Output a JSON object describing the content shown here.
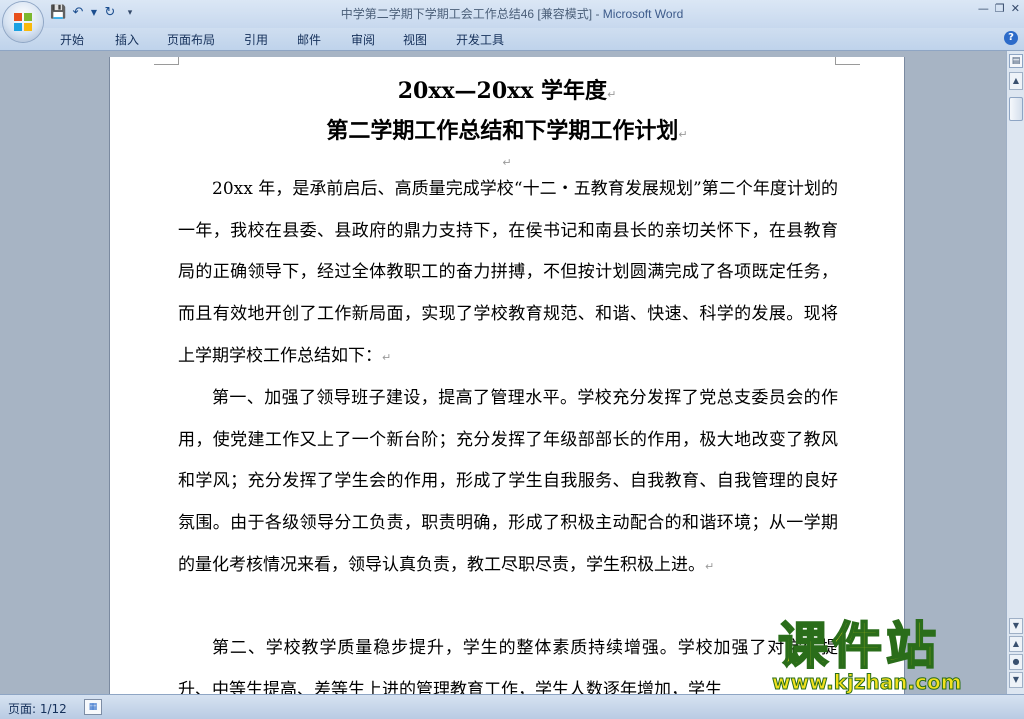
{
  "titlebar": {
    "doc_name": "中学第二学期下学期工会工作总结46 [兼容模式]",
    "separator": " - ",
    "app_name": "Microsoft Word",
    "qat_icons": [
      "save-icon",
      "undo-icon",
      "undo-dropdown-icon",
      "redo-icon",
      "customize-qat-icon"
    ],
    "window_controls": [
      "minimize-icon",
      "restore-icon",
      "close-icon"
    ]
  },
  "ribbon": {
    "tabs": [
      "开始",
      "插入",
      "页面布局",
      "引用",
      "邮件",
      "审阅",
      "视图",
      "开发工具"
    ]
  },
  "document": {
    "heading1": "20xx—20xx 学年度",
    "heading2": "第二学期工作总结和下学期工作计划",
    "paragraph_mark": "↵",
    "paragraphs": [
      "20xx 年，是承前启后、高质量完成学校“十二・五教育发展规划”第二个年度计划的一年，我校在县委、县政府的鼎力支持下，在侯书记和南县长的亲切关怀下，在县教育局的正确领导下，经过全体教职工的奋力拼搏，不但按计划圆满完成了各项既定任务，而且有效地开创了工作新局面，实现了学校教育规范、和谐、快速、科学的发展。现将上学期学校工作总结如下：",
      "第一、加强了领导班子建设，提高了管理水平。学校充分发挥了党总支委员会的作用，使党建工作又上了一个新台阶；充分发挥了年级部部长的作用，极大地改变了教风和学风；充分发挥了学生会的作用，形成了学生自我服务、自我教育、自我管理的良好氛围。由于各级领导分工负责，职责明确，形成了积极主动配合的和谐环境；从一学期的量化考核情况来看，领导认真负责，教工尽职尽责，学生积极上进。",
      "第二、学校教学质量稳步提升，学生的整体素质持续增强。学校加强了对学生提升、中等生提高、差等生上进的管理教育工作，学生人数逐年增加，学生"
    ]
  },
  "statusbar": {
    "page_indicator": "页面: 1/12"
  },
  "watermark": {
    "main": "课件站",
    "url": "www.kjzhan.com"
  },
  "colors": {
    "ribbon_bg": "#c7d8ee",
    "workspace_bg": "#a7b4c4",
    "watermark_fill": "#f2e11d",
    "watermark_stroke": "#2a6d1a"
  }
}
